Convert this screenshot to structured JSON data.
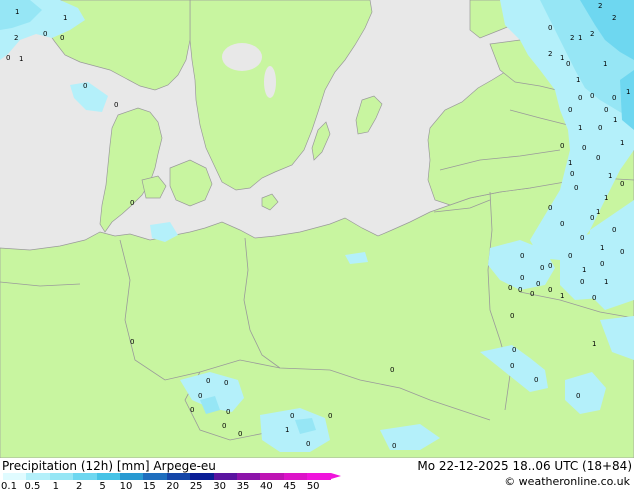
{
  "title": "Precipitation (12h) [mm] Arpege-eu",
  "valid_time": "Mo 22-12-2025 18..06 UTC (18+84)",
  "credit": "© weatheronline.co.uk",
  "legend": {
    "labels": [
      "0.1",
      "0.5",
      "1",
      "2",
      "5",
      "10",
      "15",
      "20",
      "25",
      "30",
      "35",
      "40",
      "45",
      "50"
    ],
    "colors": [
      "#e0fbff",
      "#b4f0fa",
      "#96e6f5",
      "#6ed7f0",
      "#46c3e6",
      "#289ad2",
      "#1e6ebe",
      "#1446a8",
      "#0a1e96",
      "#5a14a0",
      "#8c14aa",
      "#be14b4",
      "#dc14c8",
      "#f014dc"
    ]
  },
  "map": {
    "colors": {
      "sea": "#e8e8e8",
      "land": "#c8f5a0",
      "light_precip": "#b4f0fa",
      "moderate_precip": "#96e6f5",
      "heavy_precip": "#6ed7f0"
    },
    "point_values": [
      "1",
      "2",
      "0",
      "1",
      "0",
      "0",
      "1",
      "2",
      "2",
      "2",
      "0",
      "1",
      "0",
      "0",
      "0",
      "1",
      "2",
      "1",
      "0",
      "0",
      "1",
      "1",
      "0",
      "0",
      "1",
      "0",
      "1",
      "0",
      "0",
      "0",
      "1",
      "0",
      "0",
      "0",
      "1",
      "1",
      "0",
      "1",
      "0",
      "0",
      "0",
      "0",
      "0",
      "0",
      "0",
      "0",
      "0",
      "0",
      "0",
      "1",
      "0",
      "0",
      "0",
      "0",
      "0",
      "0",
      "0",
      "1",
      "0",
      "0",
      "0",
      "0",
      "2",
      "0",
      "1",
      "0",
      "1",
      "0",
      "0",
      "1",
      "0",
      "0",
      "0",
      "0",
      "1",
      "1",
      "0",
      "0",
      "0",
      "0",
      "0",
      "0",
      "0",
      "0"
    ]
  }
}
